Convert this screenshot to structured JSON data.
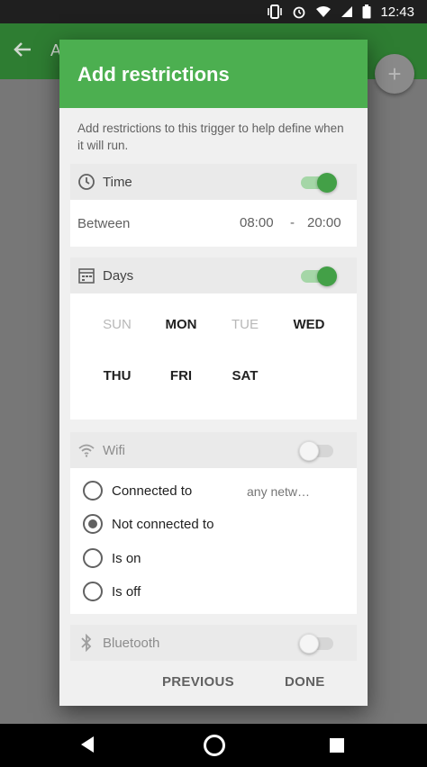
{
  "status_bar": {
    "time": "12:43"
  },
  "background": {
    "title_peek": "A",
    "back_icon": "arrow-left-icon",
    "fab_icon": "plus-icon"
  },
  "dialog": {
    "title": "Add restrictions",
    "intro": "Add restrictions to this trigger to help define when it will run.",
    "time": {
      "label": "Time",
      "enabled": true,
      "between_label": "Between",
      "from": "08:00",
      "separator": "-",
      "to": "20:00"
    },
    "days": {
      "label": "Days",
      "enabled": true,
      "items": [
        {
          "label": "SUN",
          "selected": false
        },
        {
          "label": "MON",
          "selected": true
        },
        {
          "label": "TUE",
          "selected": false
        },
        {
          "label": "WED",
          "selected": true
        },
        {
          "label": "THU",
          "selected": true
        },
        {
          "label": "FRI",
          "selected": true
        },
        {
          "label": "SAT",
          "selected": true
        }
      ]
    },
    "wifi": {
      "label": "Wifi",
      "enabled": false,
      "options": [
        {
          "label": "Connected to",
          "checked": false
        },
        {
          "label": "Not connected to",
          "checked": true
        },
        {
          "label": "Is on",
          "checked": false
        },
        {
          "label": "Is off",
          "checked": false
        }
      ],
      "network": "any netw…"
    },
    "bluetooth": {
      "label": "Bluetooth",
      "enabled": false
    },
    "actions": {
      "previous": "PREVIOUS",
      "done": "DONE"
    }
  },
  "colors": {
    "accent": "#4caf50",
    "toggle_on": "#43a047",
    "app_bar": "#2e7d32"
  }
}
